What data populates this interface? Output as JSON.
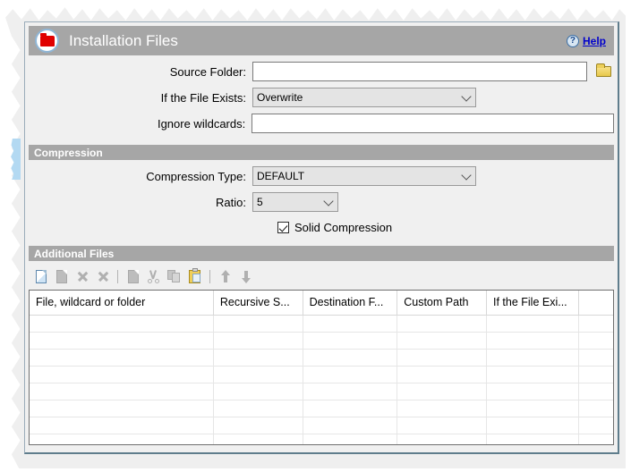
{
  "window": {
    "title": "Installation Files",
    "title_icon": "red-folder-icon",
    "help_icon": "?",
    "help_label": "Help",
    "colors": {
      "section_header_bg": "#a6a6a6",
      "title_bar_bg": "#a6a6a6",
      "help_link": "#0000cc",
      "panel_bg": "#f0f0f0",
      "accent_folder": "#e00000"
    }
  },
  "form": {
    "source_folder": {
      "label": "Source Folder:",
      "value": "",
      "placeholder": "",
      "browse_icon": "folder-open-icon"
    },
    "if_file_exists": {
      "label": "If the File Exists:",
      "value": "Overwrite"
    },
    "ignore_wildcards": {
      "label": "Ignore wildcards:",
      "value": "",
      "placeholder": ""
    }
  },
  "compression": {
    "section_title": "Compression",
    "compression_type": {
      "label": "Compression Type:",
      "value": "DEFAULT"
    },
    "ratio": {
      "label": "Ratio:",
      "value": "5"
    },
    "solid_compression": {
      "label": "Solid Compression",
      "checked": true
    }
  },
  "additional_files": {
    "section_title": "Additional Files",
    "toolbar": [
      {
        "name": "new-document-icon",
        "icon": "ic-newdoc",
        "enabled": true
      },
      {
        "name": "duplicate-document-icon",
        "icon": "ic-doc-grey",
        "enabled": false
      },
      {
        "name": "delete-icon",
        "icon": "ic-x",
        "enabled": false
      },
      {
        "name": "delete-all-icon",
        "icon": "ic-x",
        "enabled": false
      },
      {
        "name": "separator",
        "icon": "sep",
        "enabled": false
      },
      {
        "name": "document-icon",
        "icon": "ic-doc-grey",
        "enabled": false
      },
      {
        "name": "cut-icon",
        "icon": "ic-scissors",
        "enabled": false
      },
      {
        "name": "copy-icon",
        "icon": "ic-copy",
        "enabled": false
      },
      {
        "name": "paste-icon",
        "icon": "ic-paste",
        "enabled": true
      },
      {
        "name": "separator",
        "icon": "sep",
        "enabled": false
      },
      {
        "name": "move-up-icon",
        "icon": "ic-arrow-up",
        "enabled": false
      },
      {
        "name": "move-down-icon",
        "icon": "ic-arrow-dn",
        "enabled": false
      }
    ],
    "table": {
      "columns": [
        "File, wildcard or folder",
        "Recursive S...",
        "Destination F...",
        "Custom Path",
        "If the File Exi...",
        ""
      ],
      "column_widths": [
        "31.5%",
        "15.3%",
        "16.2%",
        "15.3%",
        "15.8%",
        "5.9%"
      ],
      "rows": [],
      "empty_row_count": 8
    }
  }
}
